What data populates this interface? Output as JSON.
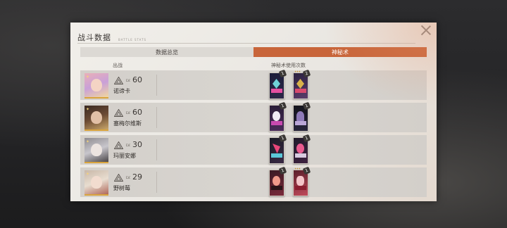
{
  "dialog": {
    "title": "战斗数据",
    "subtitle": "BATTLE STATS"
  },
  "tabs": [
    {
      "label": "数据总览",
      "active": false
    },
    {
      "label": "神秘术",
      "active": true
    }
  ],
  "columns": {
    "deploy": "出战",
    "mystic_usage": "神秘术使用次数"
  },
  "characters": [
    {
      "name": "诺谛卡",
      "lv_prefix": "LV.",
      "level": "60",
      "cards": [
        {
          "count": "1"
        },
        {
          "count": "2"
        }
      ]
    },
    {
      "name": "塞梅尔维斯",
      "lv_prefix": "LV.",
      "level": "60",
      "cards": [
        {
          "count": "1"
        },
        {
          "count": "1"
        }
      ]
    },
    {
      "name": "玛丽安娜",
      "lv_prefix": "LV.",
      "level": "30",
      "cards": [
        {
          "count": "1"
        },
        {
          "count": "1"
        }
      ]
    },
    {
      "name": "野树莓",
      "lv_prefix": "LV.",
      "level": "29",
      "cards": [
        {
          "count": "1"
        },
        {
          "count": "1"
        }
      ]
    }
  ],
  "colors": {
    "accent": "#c8653a",
    "tab_inactive": "#dcd9d4",
    "row_bg": "#d5d1cc"
  }
}
